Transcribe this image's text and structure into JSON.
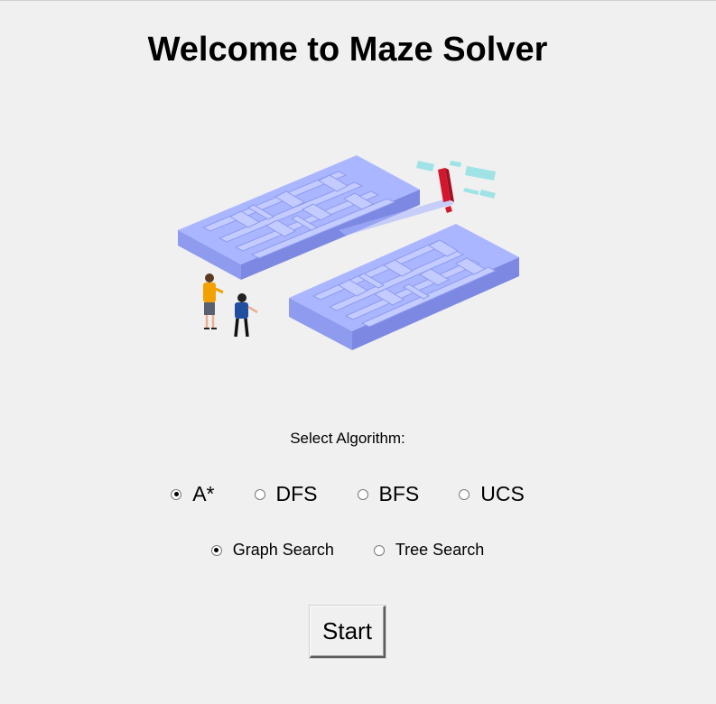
{
  "title": "Welcome to Maze Solver",
  "select_label": "Select Algorithm:",
  "algorithms": [
    {
      "label": "A*",
      "selected": true
    },
    {
      "label": "DFS",
      "selected": false
    },
    {
      "label": "BFS",
      "selected": false
    },
    {
      "label": "UCS",
      "selected": false
    }
  ],
  "search_modes": [
    {
      "label": "Graph Search",
      "selected": true
    },
    {
      "label": "Tree Search",
      "selected": false
    }
  ],
  "start_label": "Start",
  "colors": {
    "background": "#f0f0f0",
    "maze_top": "#aab6ff",
    "maze_side": "#8793ea",
    "exclamation": "#d3182e",
    "signal": "#9fe3e6"
  },
  "illustration": {
    "icon": "maze-illustration-icon"
  }
}
